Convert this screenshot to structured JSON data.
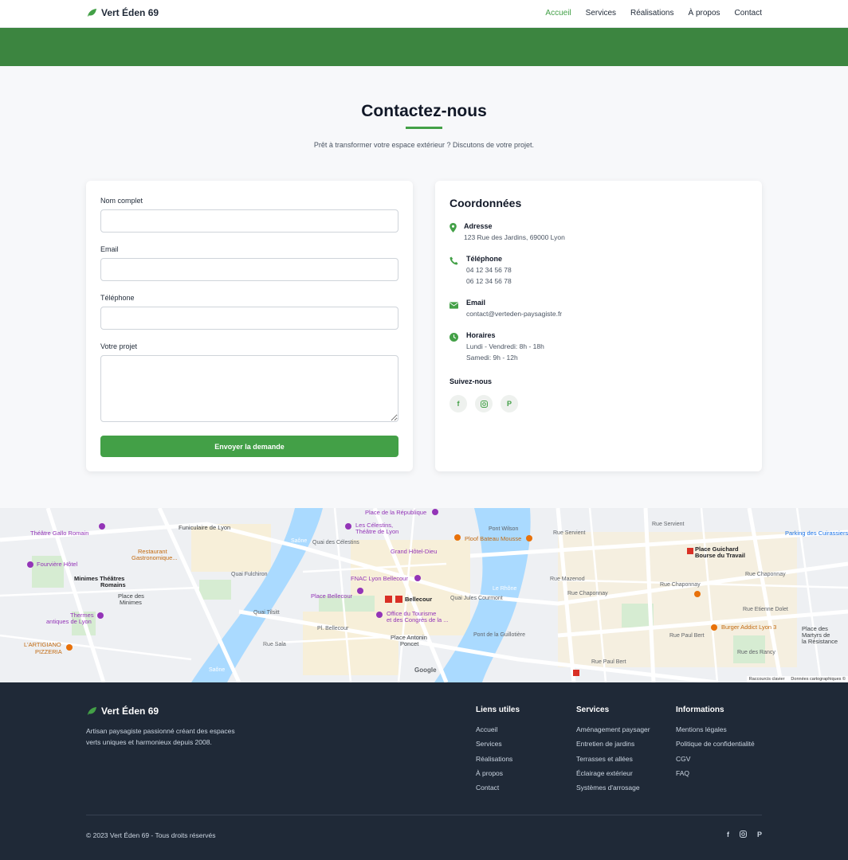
{
  "nav": {
    "brand": "Vert Éden 69",
    "links": [
      "Accueil",
      "Services",
      "Réalisations",
      "À propos",
      "Contact"
    ]
  },
  "contact": {
    "title": "Contactez-nous",
    "subtitle": "Prêt à transformer votre espace extérieur ? Discutons de votre projet."
  },
  "form": {
    "name_label": "Nom complet",
    "email_label": "Email",
    "phone_label": "Téléphone",
    "project_label": "Votre projet",
    "name_value": "",
    "email_value": "",
    "phone_value": "",
    "project_value": "",
    "submit_label": "Envoyer la demande"
  },
  "info": {
    "title": "Coordonnées",
    "address_label": "Adresse",
    "address_value": "123 Rue des Jardins, 69000 Lyon",
    "phone_label": "Téléphone",
    "phone_1": "04 12 34 56 78",
    "phone_2": "06 12 34 56 78",
    "email_label": "Email",
    "email_value": "contact@verteden-paysagiste.fr",
    "hours_label": "Horaires",
    "hours_1": "Lundi - Vendredi: 8h - 18h",
    "hours_2": "Samedi: 9h - 12h",
    "follow_label": "Suivez-nous"
  },
  "map": {
    "labels": {
      "place_republique": "Place de la République",
      "theatre_gallo": "Théâtre Gallo Romain",
      "funiculaire": "Funiculaire de Lyon",
      "celestins": "Les Célestins,",
      "celestins2": "Théâtre de Lyon",
      "pont_wilson": "Pont Wilson",
      "rue_servient": "Rue Servient",
      "parking": "Parking des Cuirassiers",
      "restaurant": "Restaurant",
      "restaurant2": "Gastronomique...",
      "grand_hotel": "Grand Hôtel-Dieu",
      "ploof": "Ploof Bateau Mousse",
      "place_guichard": "Place Guichard",
      "bourse": "Bourse du Travail",
      "fourviere": "Fourvière Hôtel",
      "fnac": "FNAC Lyon Bellecour",
      "minimes": "Minimes Théâtres",
      "minimes2": "Romains",
      "place_minimes": "Place des",
      "place_minimes2": "Minimes",
      "place_bellecour": "Place Bellecour",
      "bellecour": "Bellecour",
      "rue_mazenod": "Rue Mazenod",
      "rue_chaponnay": "Rue Chaponnay",
      "rue_dolet": "Rue Etienne Dolet",
      "thermes": "Thermes",
      "thermes2": "antiques de Lyon",
      "office": "Office du Tourisme",
      "office2": "et des Congrès de la ...",
      "burger": "Burger Addict Lyon 3",
      "artigiano": "L'ARTIGIANO",
      "artigiano2": "PIZZERIA",
      "pl_bellecour": "Pl. Bellecour",
      "place_antonin": "Place Antonin",
      "place_antonin2": "Poncet",
      "pont_guillotiere": "Pont de la Guillotière",
      "rue_paul_bert": "Rue Paul Bert",
      "rue_rancy": "Rue des Rancy",
      "martyrs": "Place des",
      "martyrs2": "Martyrs de",
      "martyrs3": "la Résistance",
      "saone": "Saône",
      "rhone": "Le Rhône",
      "quai_fulchiron": "Quai Fulchiron",
      "quai_tilsitt": "Quai Tilsitt",
      "quai_jules": "Quai Jules Courmont",
      "quai_celestins": "Quai des Célestins",
      "rue_sala": "Rue Sala",
      "google": "Google",
      "shortcuts": "Raccourcis clavier",
      "data": "Données cartographiques ©"
    }
  },
  "footer": {
    "brand": "Vert Éden 69",
    "about": "Artisan paysagiste passionné créant des espaces verts uniques et harmonieux depuis 2008.",
    "col1_title": "Liens utiles",
    "col1": [
      "Accueil",
      "Services",
      "Réalisations",
      "À propos",
      "Contact"
    ],
    "col2_title": "Services",
    "col2": [
      "Aménagement paysager",
      "Entretien de jardins",
      "Terrasses et allées",
      "Éclairage extérieur",
      "Systèmes d'arrosage"
    ],
    "col3_title": "Informations",
    "col3": [
      "Mentions légales",
      "Politique de confidentialité",
      "CGV",
      "FAQ"
    ],
    "copyright": "© 2023 Vert Éden 69 - Tous droits réservés"
  },
  "colors": {
    "accent": "#43a047",
    "hero": "#3c8540",
    "footer": "#1f2937"
  }
}
